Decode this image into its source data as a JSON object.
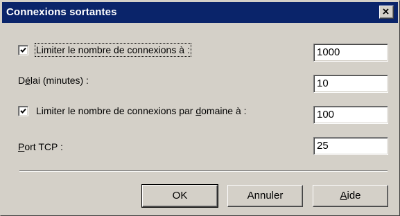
{
  "window": {
    "title": "Connexions sortantes",
    "close_icon": "close-icon"
  },
  "fields": [
    {
      "label": "Limiter le nombre de connexions à :",
      "checked": true,
      "value": "1000"
    },
    {
      "label_pre": "D",
      "label_accel": "é",
      "label_post": "lai (minutes) :",
      "value": "10"
    },
    {
      "label_pre": "Limiter le nombre de connexions par ",
      "label_accel": "d",
      "label_post": "omaine à :",
      "checked": true,
      "value": "100"
    },
    {
      "label_pre": "",
      "label_accel": "P",
      "label_post": "ort TCP :",
      "value": "25"
    }
  ],
  "buttons": {
    "ok": "OK",
    "cancel": "Annuler",
    "help_accel": "A",
    "help_rest": "ide"
  },
  "colors": {
    "titlebar": "#0a246a",
    "dialog_bg": "#d4d0c8"
  }
}
